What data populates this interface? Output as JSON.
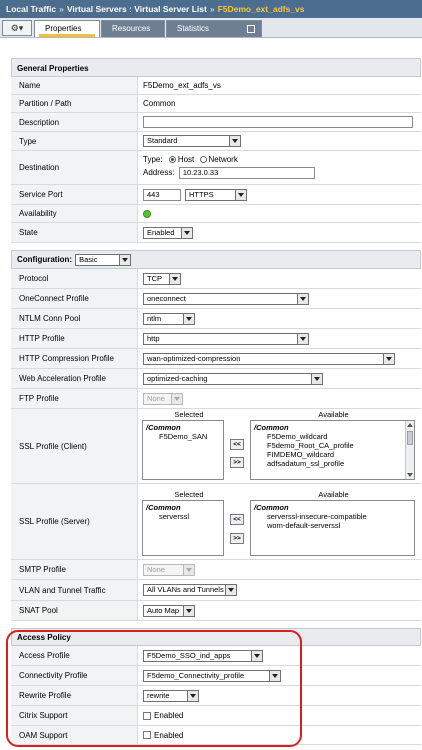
{
  "breadcrumb": {
    "part1": "Local Traffic",
    "part2": "Virtual Servers : Virtual Server List",
    "part3": "F5Demo_ext_adfs_vs",
    "separator": "»"
  },
  "tabs": {
    "gear_arrow": "▾",
    "properties": "Properties",
    "resources": "Resources",
    "statistics": "Statistics"
  },
  "general": {
    "title": "General Properties",
    "name_label": "Name",
    "name_value": "F5Demo_ext_adfs_vs",
    "partition_label": "Partition / Path",
    "partition_value": "Common",
    "description_label": "Description",
    "description_value": "",
    "type_label": "Type",
    "type_value": "Standard",
    "destination_label": "Destination",
    "dest_type_label": "Type:",
    "dest_host": "Host",
    "dest_network": "Network",
    "dest_address_label": "Address:",
    "dest_address": "10.23.0.33",
    "service_port_label": "Service Port",
    "service_port": "443",
    "service_port_name": "HTTPS",
    "availability_label": "Availability",
    "state_label": "State",
    "state_value": "Enabled"
  },
  "configuration": {
    "title": "Configuration:",
    "mode": "Basic",
    "protocol_label": "Protocol",
    "protocol_value": "TCP",
    "oneconnect_label": "OneConnect Profile",
    "oneconnect_value": "oneconnect",
    "ntlm_label": "NTLM Conn Pool",
    "ntlm_value": "ntlm",
    "http_label": "HTTP Profile",
    "http_value": "http",
    "http_comp_label": "HTTP Compression Profile",
    "http_comp_value": "wan-optimized-compression",
    "web_accel_label": "Web Acceleration Profile",
    "web_accel_value": "optimized-caching",
    "ftp_label": "FTP Profile",
    "ftp_value": "None",
    "ssl_client_label": "SSL Profile (Client)",
    "ssl_client_selected_caption": "Selected",
    "ssl_client_available_caption": "Available",
    "ssl_client_selected_group": "/Common",
    "ssl_client_selected_items": [
      "F5Demo_SAN"
    ],
    "ssl_client_available_group": "/Common",
    "ssl_client_available_items": [
      "F5Demo_wildcard",
      "F5demo_Root_CA_profile",
      "FIMDEMO_wildcard",
      "adfsadatum_ssl_profile"
    ],
    "ssl_server_label": "SSL Profile (Server)",
    "ssl_server_selected_caption": "Selected",
    "ssl_server_available_caption": "Available",
    "ssl_server_selected_group": "/Common",
    "ssl_server_selected_items": [
      "serverssl"
    ],
    "ssl_server_available_group": "/Common",
    "ssl_server_available_items": [
      "serverssl-insecure-compatible",
      "wom-default-serverssl"
    ],
    "move_left": "<<",
    "move_right": ">>",
    "smtp_label": "SMTP Profile",
    "smtp_value": "None",
    "vlan_label": "VLAN and Tunnel Traffic",
    "vlan_value": "All VLANs and Tunnels",
    "snat_label": "SNAT Pool",
    "snat_value": "Auto Map"
  },
  "access_policy": {
    "title": "Access Policy",
    "access_profile_label": "Access Profile",
    "access_profile_value": "F5Demo_SSO_ind_apps",
    "connectivity_label": "Connectivity Profile",
    "connectivity_value": "F5demo_Connectivity_profile",
    "rewrite_label": "Rewrite Profile",
    "rewrite_value": "rewrite",
    "citrix_label": "Citrix Support",
    "citrix_value": "Enabled",
    "oam_label": "OAM Support",
    "oam_value": "Enabled"
  },
  "colors": {
    "header_bar": "#4d6d8f",
    "breadcrumb_current": "#f4c542",
    "highlight": "#d9201f",
    "availability": "#5cc232"
  }
}
